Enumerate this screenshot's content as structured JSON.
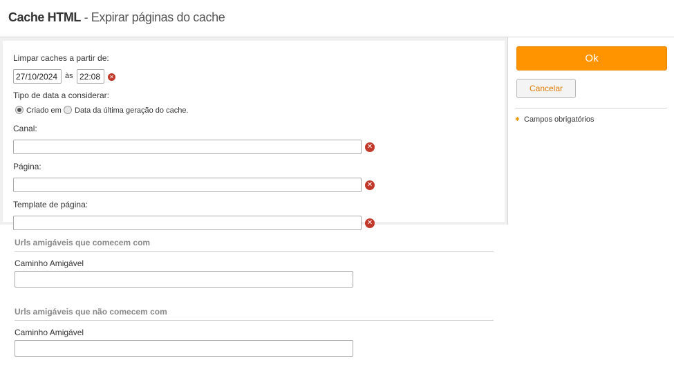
{
  "header": {
    "title_bold": "Cache HTML",
    "title_rest": " - Expirar páginas do cache"
  },
  "form": {
    "clear_from_label": "Limpar caches a partir de:",
    "date_value": "27/10/2024",
    "at_label": "às",
    "time_value": "22:08",
    "date_type_label": "Tipo de data a considerar:",
    "radio_options": [
      {
        "label": "Criado em",
        "checked": true
      },
      {
        "label": "Data da última geração do cache.",
        "checked": false
      }
    ],
    "channel_label": "Canal:",
    "channel_value": "",
    "page_label": "Página:",
    "page_value": "",
    "template_label": "Template de página:",
    "template_value": ""
  },
  "friendly_urls": {
    "starting_title": "Urls amigáveis que comecem com",
    "starting_field_label": "Caminho Amigável",
    "starting_value": "",
    "not_starting_title": "Urls amigáveis que não comecem com",
    "not_starting_field_label": "Caminho Amigável",
    "not_starting_value": ""
  },
  "sidebar": {
    "ok_label": "Ok",
    "cancel_label": "Cancelar",
    "required_note": "Campos obrigatórios"
  },
  "colors": {
    "accent": "#ff9400",
    "clear_icon": "#c0392b",
    "cancel_text": "#e07a00"
  },
  "icons": {
    "clear": "clear-icon",
    "required": "required-marker-icon"
  }
}
